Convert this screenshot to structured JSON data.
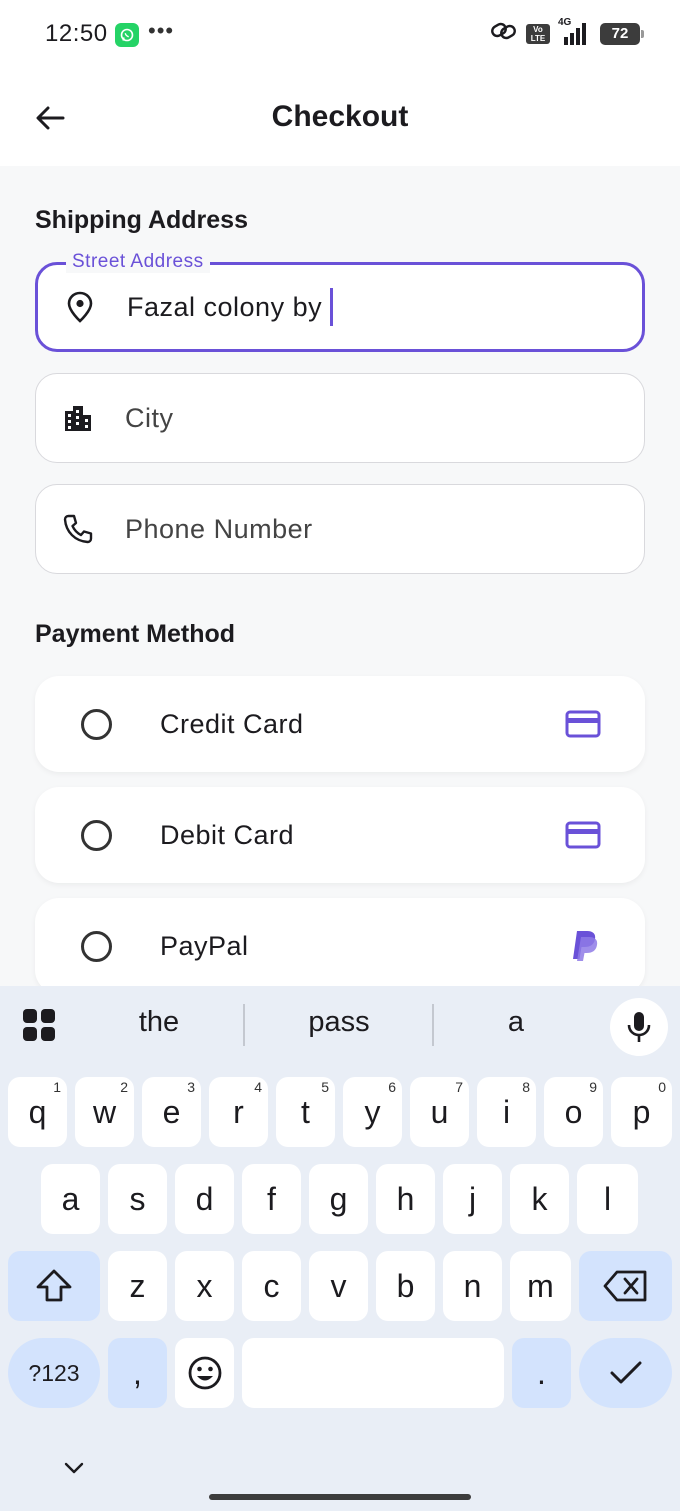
{
  "status_bar": {
    "time": "12:50",
    "overflow": "•••",
    "volte": "Vo LTE",
    "network": "4G",
    "battery": "72",
    "icons": [
      "whatsapp-icon",
      "link-icon",
      "volte-icon",
      "signal-icon",
      "battery-icon"
    ]
  },
  "app_bar": {
    "title": "Checkout",
    "back_icon": "arrow-left-icon"
  },
  "shipping": {
    "title": "Shipping Address",
    "street": {
      "label": "Street Address",
      "value": "Fazal colony by",
      "icon": "location-pin-icon"
    },
    "city": {
      "placeholder": "City",
      "value": "",
      "icon": "city-icon"
    },
    "phone": {
      "placeholder": "Phone Number",
      "value": "",
      "icon": "phone-icon"
    }
  },
  "payment": {
    "title": "Payment Method",
    "options": [
      {
        "label": "Credit Card",
        "icon": "credit-card-icon",
        "selected": false
      },
      {
        "label": "Debit Card",
        "icon": "credit-card-icon",
        "selected": false
      },
      {
        "label": "PayPal",
        "icon": "paypal-icon",
        "selected": false
      }
    ],
    "accent": "#6a51d8"
  },
  "keyboard": {
    "suggestions": [
      "the",
      "pass",
      "a"
    ],
    "row1": [
      {
        "k": "q",
        "n": "1"
      },
      {
        "k": "w",
        "n": "2"
      },
      {
        "k": "e",
        "n": "3"
      },
      {
        "k": "r",
        "n": "4"
      },
      {
        "k": "t",
        "n": "5"
      },
      {
        "k": "y",
        "n": "6"
      },
      {
        "k": "u",
        "n": "7"
      },
      {
        "k": "i",
        "n": "8"
      },
      {
        "k": "o",
        "n": "9"
      },
      {
        "k": "p",
        "n": "0"
      }
    ],
    "row2": [
      "a",
      "s",
      "d",
      "f",
      "g",
      "h",
      "j",
      "k",
      "l"
    ],
    "row3": [
      "z",
      "x",
      "c",
      "v",
      "b",
      "n",
      "m"
    ],
    "symbols_label": "?123",
    "comma": ",",
    "period": ".",
    "icons": [
      "apps-grid-icon",
      "microphone-icon",
      "shift-icon",
      "backspace-icon",
      "emoji-icon",
      "checkmark-icon",
      "chevron-down-icon"
    ]
  },
  "colors": {
    "accent": "#6a51d8",
    "keyboard_bg": "#e9eef6",
    "special_key": "#d3e3fd",
    "content_bg": "#f7f8f9"
  }
}
